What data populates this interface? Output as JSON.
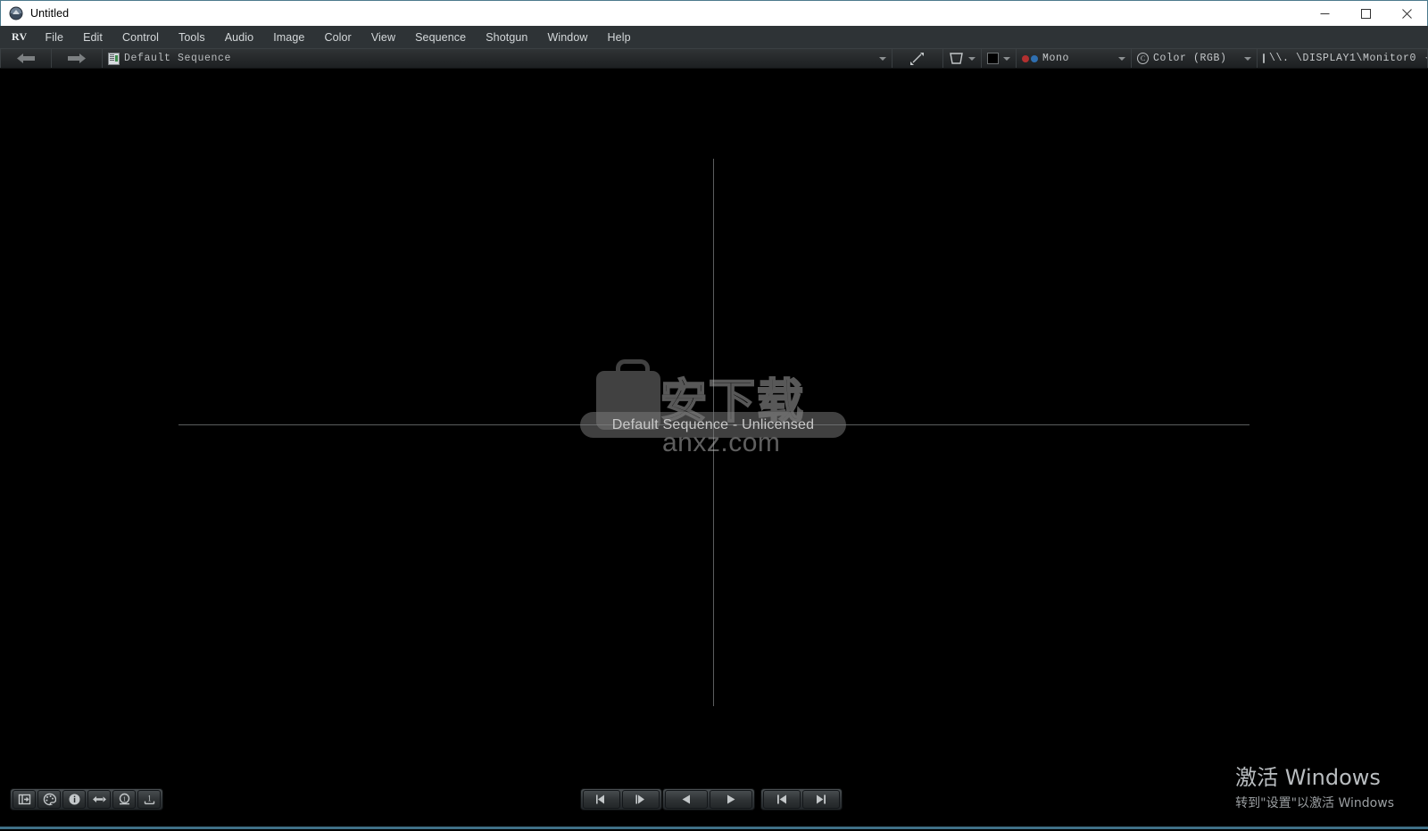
{
  "window": {
    "title": "Untitled",
    "app_icon": "rv-app-icon",
    "controls": {
      "minimize": "minimize-icon",
      "maximize": "maximize-icon",
      "close": "close-icon"
    }
  },
  "menubar": {
    "logo": "RV",
    "items": [
      {
        "label": "File"
      },
      {
        "label": "Edit"
      },
      {
        "label": "Control"
      },
      {
        "label": "Tools"
      },
      {
        "label": "Audio"
      },
      {
        "label": "Image"
      },
      {
        "label": "Color"
      },
      {
        "label": "View"
      },
      {
        "label": "Sequence"
      },
      {
        "label": "Shotgun"
      },
      {
        "label": "Window"
      },
      {
        "label": "Help"
      }
    ]
  },
  "toolbar": {
    "back_icon": "arrow-left-icon",
    "forward_icon": "arrow-right-icon",
    "sequence_icon": "sequence-file-icon",
    "sequence_name": "Default Sequence",
    "sequence_caret": "chevron-down-icon",
    "scale_icon": "diagonal-resize-icon",
    "frame_icon": "frame-crop-icon",
    "frame_caret": "chevron-down-icon",
    "background_swatch": "#000000",
    "background_caret": "chevron-down-icon",
    "stereo_mode": "Mono",
    "stereo_dot_left": "#b23030",
    "stereo_dot_right": "#2f6fb0",
    "stereo_caret": "chevron-down-icon",
    "color_mode": "Color (RGB)",
    "color_icon": "C",
    "color_caret": "chevron-down-icon",
    "display_device": "\\\\. \\DISPLAY1\\Monitor0",
    "display_icon": "monitor-icon",
    "display_caret": "chevron-down-icon"
  },
  "viewport": {
    "center_label": "Default Sequence - Unlicensed",
    "crosshair_color": "#5b5d5e",
    "background": "#000000",
    "watermark": {
      "icon": "shopping-bag-icon",
      "text_cn": "安下载",
      "url": "anxz.com"
    }
  },
  "bottombar": {
    "tools": [
      {
        "name": "session-manager-icon",
        "glyph": "E"
      },
      {
        "name": "color-wheel-icon",
        "glyph": "palette"
      },
      {
        "name": "info-icon",
        "glyph": "i"
      },
      {
        "name": "sync-swap-icon",
        "glyph": "swap"
      },
      {
        "name": "annotate-circle-icon",
        "glyph": "1"
      },
      {
        "name": "baseline-icon",
        "glyph": "1_"
      }
    ],
    "transport": {
      "step_back": "step-back-icon",
      "step_forward": "step-forward-icon",
      "play_reverse": "play-reverse-icon",
      "play_forward": "play-forward-icon",
      "go_start": "skip-to-start-icon",
      "go_end": "skip-to-end-icon"
    },
    "accent_color": "#3f6f86"
  },
  "activation": {
    "line1": "激活 Windows",
    "line2": "转到\"设置\"以激活 Windows"
  }
}
